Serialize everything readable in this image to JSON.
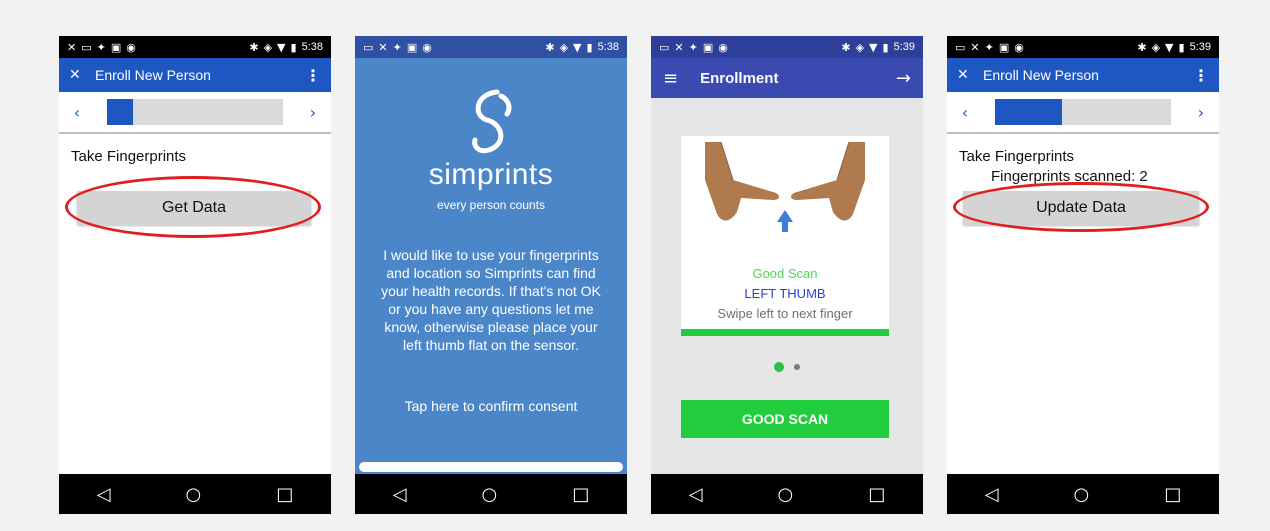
{
  "phone1": {
    "status_time": "5:38",
    "appbar_title": "Enroll New Person",
    "pager_prev": "‹",
    "pager_next": "›",
    "progress_fraction": 0.15,
    "section_label": "Take Fingerprints",
    "button_label": "Get Data",
    "nav_back": "◁",
    "nav_home": "○",
    "nav_recent": "□"
  },
  "phone2": {
    "status_time": "5:38",
    "brand": "simprints",
    "tagline": "every person counts",
    "consent_text": "I would like to use your fingerprints and location so Simprints can find your health records. If that's not OK or you have any questions let me know, otherwise please place your left thumb flat on the sensor.",
    "confirm_label": "Tap here to confirm consent",
    "nav_back": "◁",
    "nav_home": "○",
    "nav_recent": "□"
  },
  "phone3": {
    "status_time": "5:39",
    "title": "Enrollment",
    "scan_status": "Good Scan",
    "finger": "LEFT THUMB",
    "instruction": "Swipe left to next finger",
    "button_label": "GOOD SCAN",
    "nav_back": "◁",
    "nav_home": "○",
    "nav_recent": "□"
  },
  "phone4": {
    "status_time": "5:39",
    "appbar_title": "Enroll New Person",
    "pager_prev": "‹",
    "pager_next": "›",
    "progress_fraction": 0.38,
    "section_label": "Take Fingerprints",
    "scanned_text": "Fingerprints scanned: 2",
    "button_label": "Update Data",
    "nav_back": "◁",
    "nav_home": "○",
    "nav_recent": "□"
  },
  "colors": {
    "appbar_blue": "#1e57c2",
    "consent_blue": "#4b86c8",
    "enroll_indigo": "#3a4ab0",
    "scan_green": "#21cc3d",
    "highlight_red": "#e02020"
  }
}
